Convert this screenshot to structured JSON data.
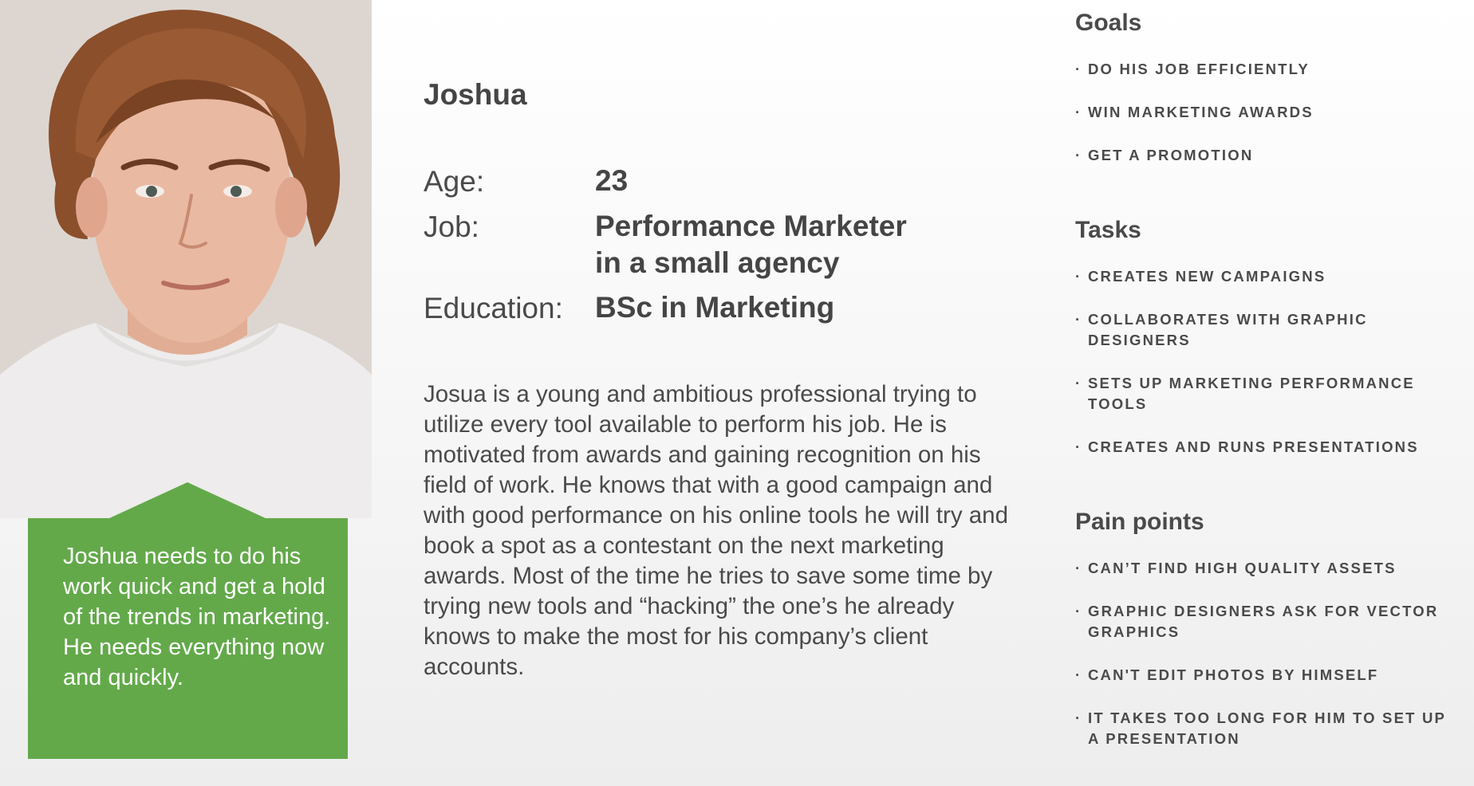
{
  "persona": {
    "name": "Joshua",
    "quote": "Joshua needs to do his work quick and get a hold of the trends in marketing. He needs everything now and quickly.",
    "facts": {
      "age_label": "Age:",
      "age_value": "23",
      "job_label": "Job:",
      "job_value_line1": "Performance Marketer",
      "job_value_line2": "in a small agency",
      "education_label": "Education:",
      "education_value": "BSc in Marketing"
    },
    "bio": "Josua is a young and ambitious professional trying to utilize every tool available to perform his job. He is motivated from awards and gaining recognition on his field of work. He knows that with a good campaign and with good performance on his online tools he will try and book a spot as a contestant on the next marketing awards. Most of the time he tries to save some time by trying new tools and “hacking” the one’s he already knows to make the most for his company’s client accounts."
  },
  "goals": {
    "title": "Goals",
    "items": [
      "Do his job efficiently",
      "Win marketing awards",
      "Get a promotion"
    ]
  },
  "tasks": {
    "title": "Tasks",
    "items": [
      "Creates new campaigns",
      "Collaborates with graphic designers",
      "Sets up marketing performance tools",
      "Creates and runs presentations"
    ]
  },
  "pain_points": {
    "title": "Pain points",
    "items": [
      "Can’t find high quality assets",
      "Graphic designers ask for vector graphics",
      "Can't edit photos by himself",
      "It takes too long for him to set up a presentation"
    ]
  },
  "colors": {
    "accent_green": "#63a94a",
    "text_dark": "#454545"
  }
}
